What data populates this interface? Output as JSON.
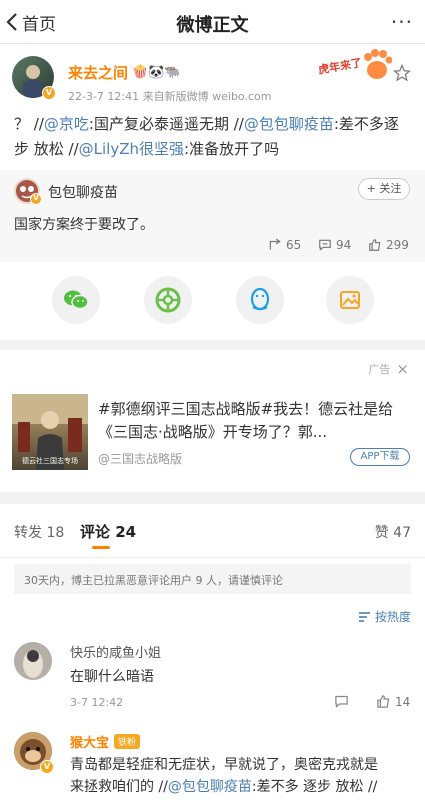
{
  "nav": {
    "back_label": "首页",
    "title": "微博正文",
    "more": "···"
  },
  "post": {
    "author": "来去之间",
    "author_emojis": "🍿🐼🐃",
    "time_source": "22-3-7 12:41  来自新版微博 weibo.com",
    "sticker_text": "虎年来了",
    "text": {
      "q": "？ //",
      "m1": "@京吃",
      "t1": ":国产复必泰遥遥无期 //",
      "m2": "@包包聊疫苗",
      "t2": ":差不多逐步 放松 //",
      "m3": "@LilyZh很坚强",
      "t3": ":准备放开了吗"
    }
  },
  "retweet": {
    "author": "包包聊疫苗",
    "follow": "+ 关注",
    "text": "国家方案终于要改了。",
    "reposts": "65",
    "comments": "94",
    "likes": "299"
  },
  "share": {
    "buttons": [
      "wechat",
      "moments",
      "qq",
      "album"
    ]
  },
  "ad": {
    "label": "广告",
    "close": "×",
    "title": "#郭德纲评三国志战略版#我去！德云社是给《三国志·战略版》开专场了？郭...",
    "source": "@三国志战略版",
    "button": "APP下载",
    "thumb_caption": "德云社三国志专场"
  },
  "tabs": {
    "repost_label": "转发",
    "repost_count": "18",
    "comment_label": "评论",
    "comment_count": "24",
    "like_label": "赞",
    "like_count": "47"
  },
  "comments": {
    "notice": "30天内，博主已拉黑恶意评论用户 9 人，请谨慎评论",
    "sort": "按热度",
    "list": [
      {
        "user": "快乐的咸鱼小姐",
        "text": "在聊什么暗语",
        "time": "3-7 12:42",
        "likes": "14"
      },
      {
        "user": "猴大宝",
        "badge": "铁粉",
        "text1": "青岛都是轻症和无症状，早就说了，奥密克戎就是",
        "text2": "来拯救咱们的 //",
        "mention": "@包包聊疫苗",
        "text3": ":差不多 逐步 放松 //"
      }
    ]
  },
  "colors": {
    "link": "#4a7fb5",
    "orange": "#ff8200",
    "accent": "#f5a623"
  }
}
